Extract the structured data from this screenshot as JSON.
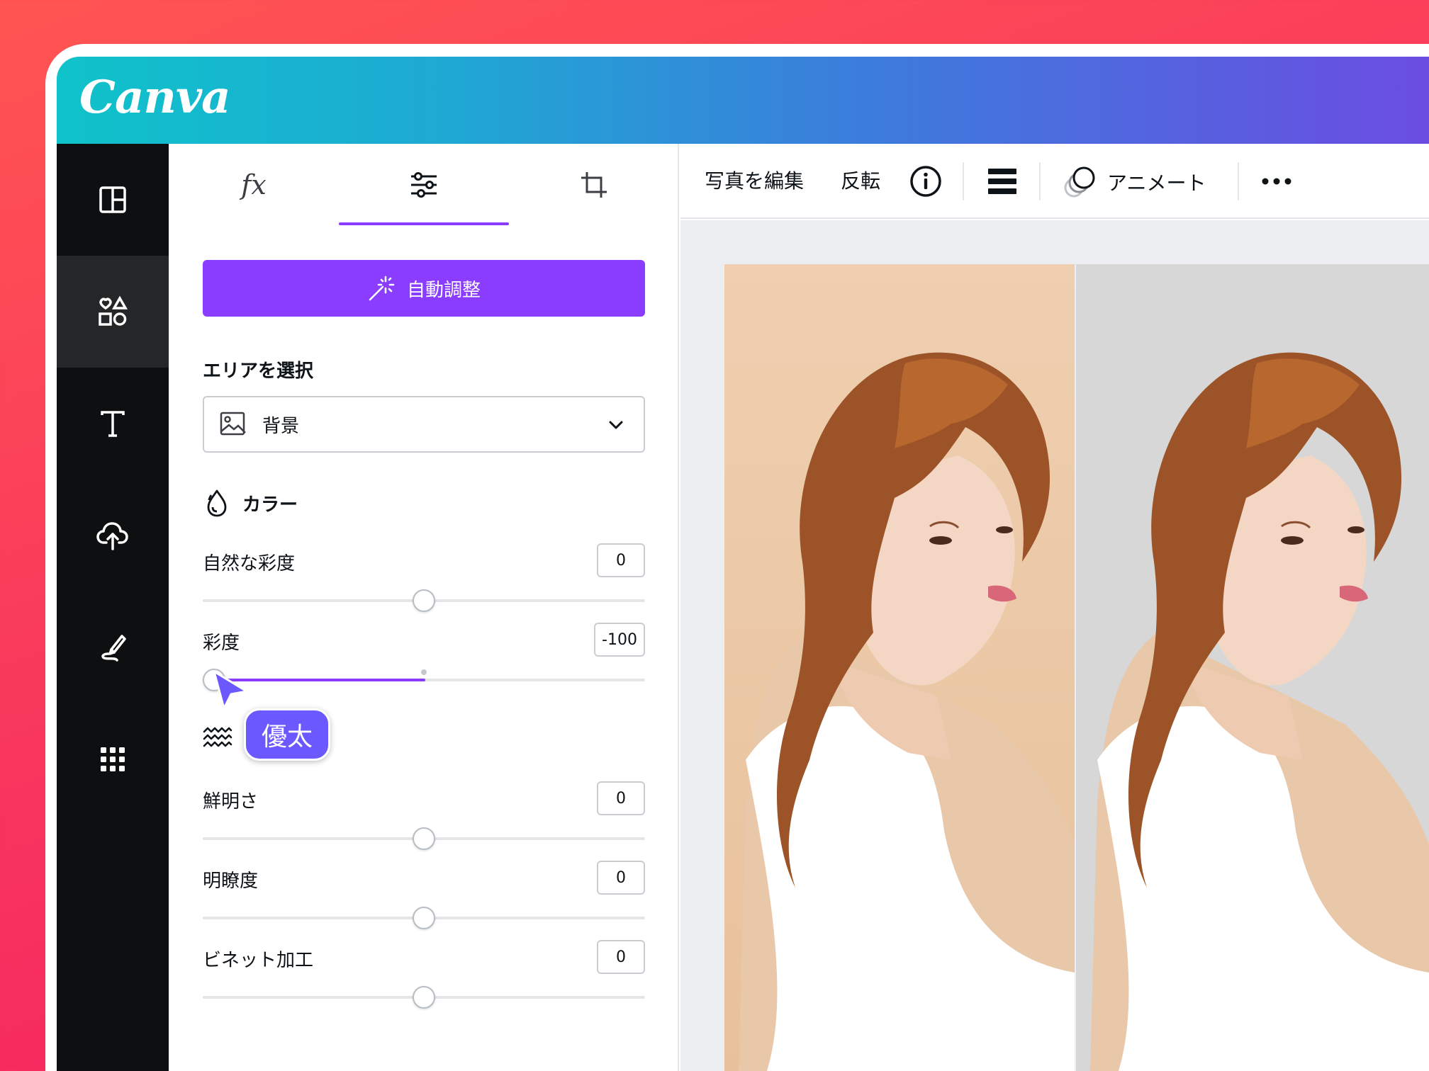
{
  "brand": {
    "logo_text": "Canva"
  },
  "colors": {
    "accent": "#8b3dff",
    "titlebar_start": "#0fc3ca",
    "titlebar_end": "#6b4de2",
    "rail_bg": "#18191b",
    "collaborator": "#6b58ff"
  },
  "sidebar": {
    "items": [
      {
        "icon": "layout-template-icon"
      },
      {
        "icon": "elements-shapes-icon"
      },
      {
        "icon": "text-icon"
      },
      {
        "icon": "upload-cloud-icon"
      },
      {
        "icon": "draw-pen-icon"
      },
      {
        "icon": "apps-grid-icon"
      }
    ],
    "active_index": 1
  },
  "panel": {
    "tabs": [
      {
        "label": "fx",
        "icon": "effects-icon"
      },
      {
        "label": "",
        "icon": "adjust-sliders-icon"
      },
      {
        "label": "",
        "icon": "crop-icon"
      }
    ],
    "active_tab": 1,
    "auto_adjust_label": "自動調整",
    "area_title": "エリアを選択",
    "area_select_value": "背景",
    "color_section_title": "カラー",
    "sliders_color": [
      {
        "label": "自然な彩度",
        "value": "0",
        "level": 0.0
      },
      {
        "label": "彩度",
        "value": "-100",
        "level": -1.0
      }
    ],
    "sliders_texture": [
      {
        "label": "鮮明さ",
        "value": "0",
        "level": 0.0
      },
      {
        "label": "明瞭度",
        "value": "0",
        "level": 0.0
      },
      {
        "label": "ビネット加工",
        "value": "0",
        "level": 0.0
      }
    ]
  },
  "collaborator": {
    "name": "優太"
  },
  "toolbar": {
    "edit_photo": "写真を編集",
    "flip": "反転",
    "info_icon": "info-icon",
    "position_icon": "position-layers-icon",
    "animate_label": "アニメート",
    "more_icon": "more-icon"
  },
  "canvas": {
    "images": [
      {
        "name": "photo-original",
        "background": "beige"
      },
      {
        "name": "photo-desaturated-background",
        "background": "gray"
      }
    ]
  }
}
